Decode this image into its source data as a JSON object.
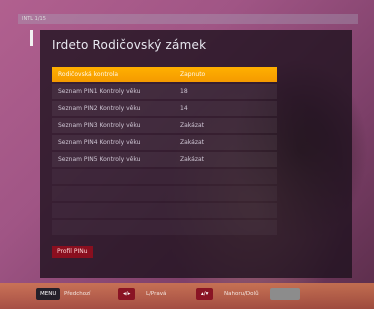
{
  "header": {
    "strip_text": "INTL 1/15",
    "title": "Irdeto Rodičovský zámek"
  },
  "menu": {
    "rows": [
      {
        "label": "Rodičovská kontrola",
        "value": "Zapnuto"
      },
      {
        "label": "Seznam PIN1 Kontroly věku",
        "value": "18"
      },
      {
        "label": "Seznam PIN2 Kontroly věku",
        "value": "14"
      },
      {
        "label": "Seznam PIN3 Kontroly věku",
        "value": "Zakázat"
      },
      {
        "label": "Seznam PIN4 Kontroly věku",
        "value": "Zakázat"
      },
      {
        "label": "Seznam PIN5 Kontroly věku",
        "value": "Zakázat"
      }
    ],
    "selected_index": 0
  },
  "pin_button": {
    "label": "Profil PINu"
  },
  "footer": {
    "menu_key": "MENU",
    "menu_label": "Předchozí",
    "lr_key": "◂/▸",
    "lr_label": "L/Pravá",
    "ud_key": "▴/▾",
    "ud_label": "Nahoru/Dolů",
    "grey_key": ""
  },
  "colors": {
    "selection": "#f7a200",
    "pin_button": "#8a0f1f",
    "panel": "#1e121e"
  }
}
